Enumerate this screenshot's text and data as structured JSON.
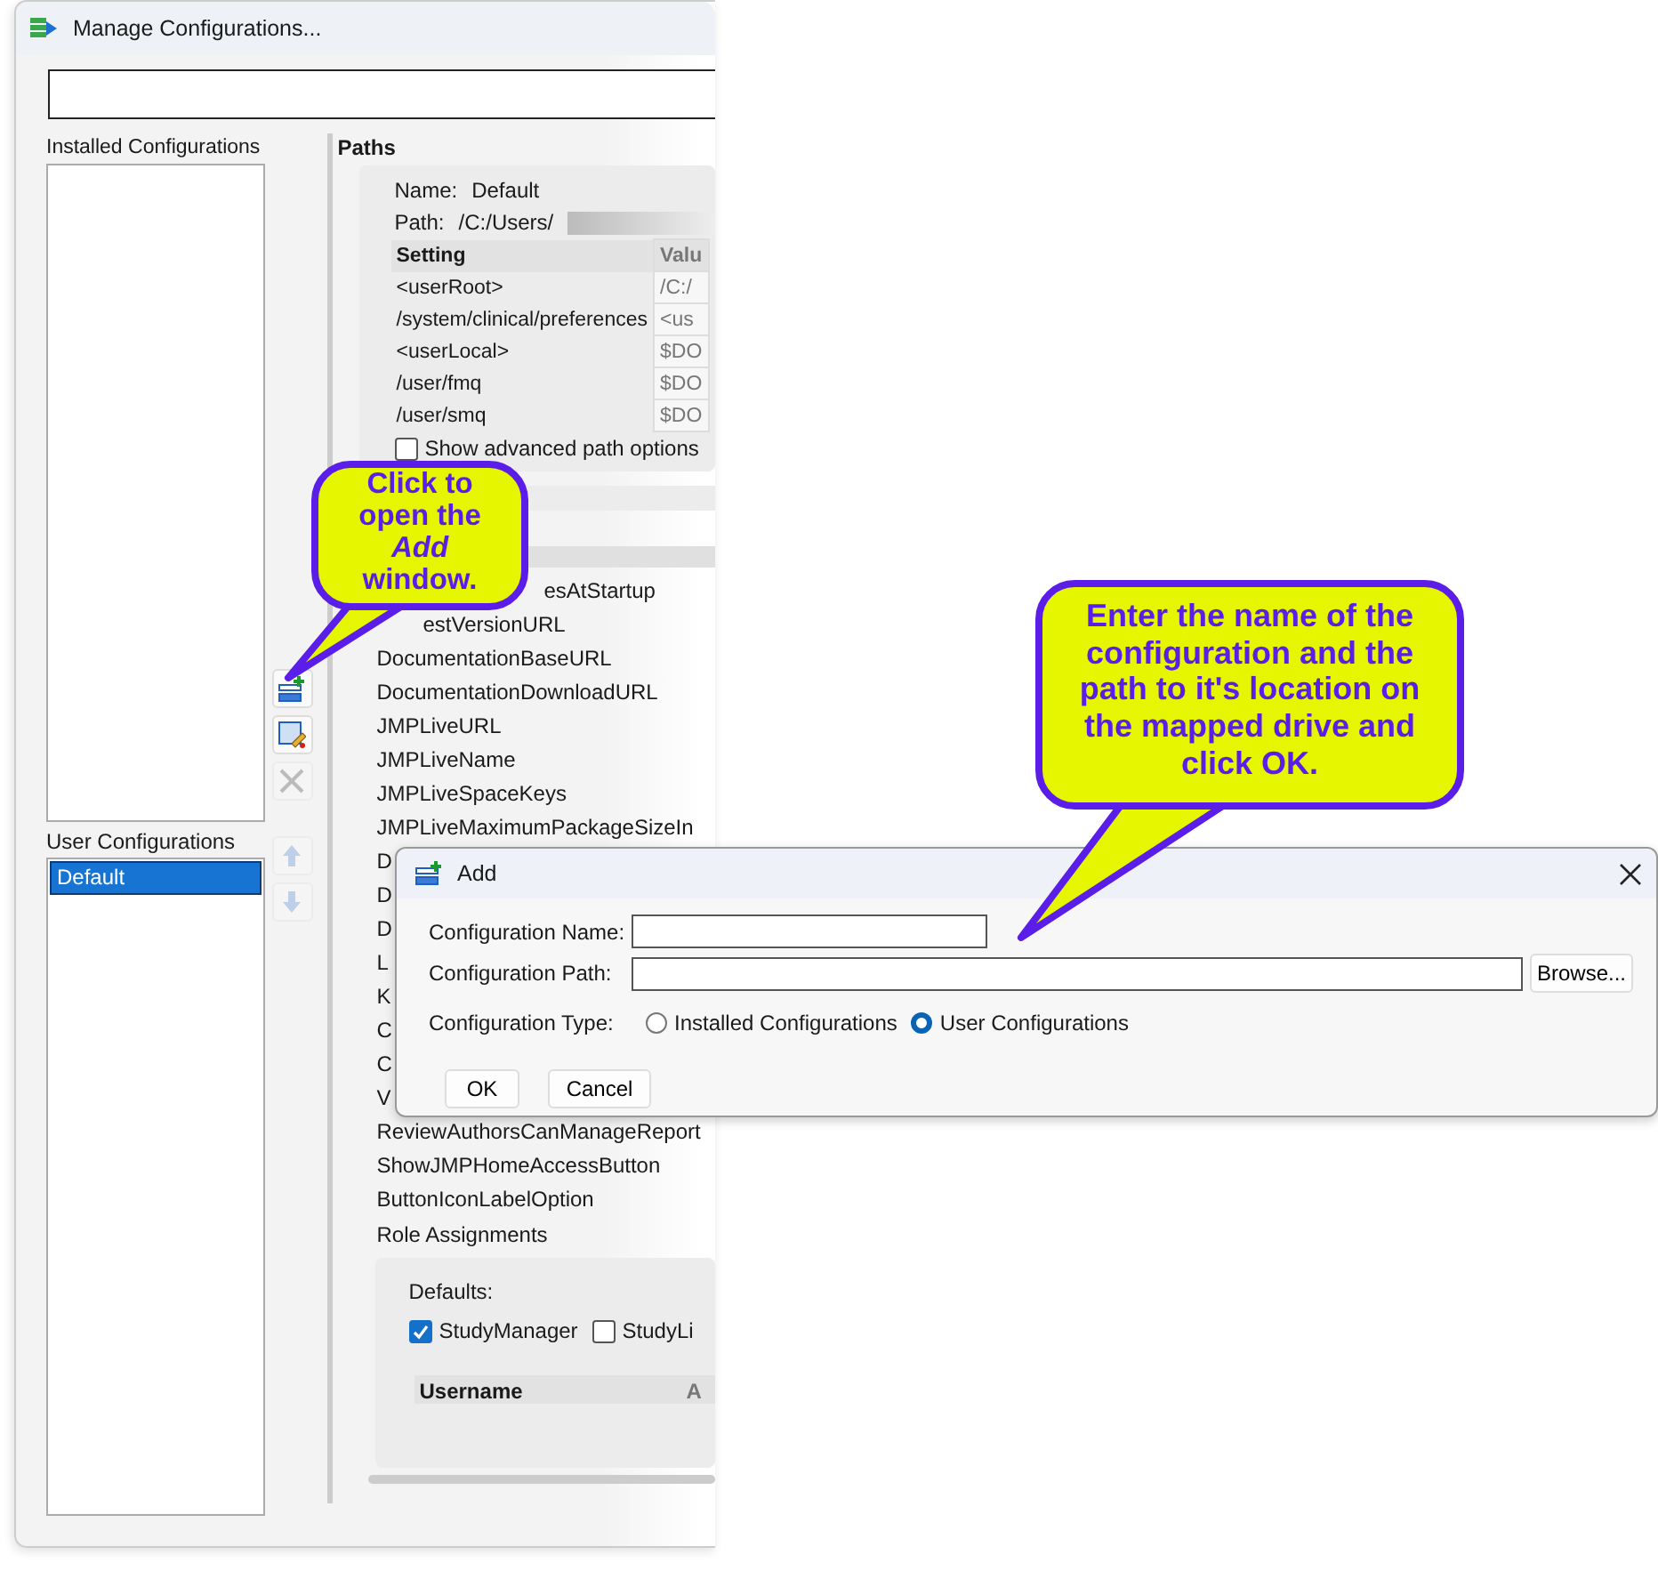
{
  "window": {
    "title": "Manage Configurations..."
  },
  "installed_configurations": {
    "label": "Installed Configurations"
  },
  "user_configurations": {
    "label": "User Configurations",
    "items": [
      {
        "text": "Default",
        "selected": true
      }
    ]
  },
  "list_buttons": [
    {
      "kind": "add",
      "disabled": false
    },
    {
      "kind": "edit",
      "disabled": false
    },
    {
      "kind": "delete",
      "disabled": true
    },
    {
      "kind": "up",
      "disabled": true
    },
    {
      "kind": "down",
      "disabled": true
    }
  ],
  "paths": {
    "title": "Paths",
    "name_label": "Name:",
    "name": "Default",
    "path_label": "Path:",
    "path": "/C:/Users/",
    "columns": [
      "Setting",
      "Valu"
    ],
    "rows": [
      [
        "<userRoot>",
        "/C:/"
      ],
      [
        "/system/clinical/preferences",
        "<us"
      ],
      [
        "<userLocal>",
        "$DO"
      ],
      [
        "/user/fmq",
        "$DO"
      ],
      [
        "/user/smq",
        "$DO"
      ]
    ],
    "advanced_option": {
      "label": "Show advanced path options",
      "checked": false
    }
  },
  "settings": [
    {
      "text": "esAtStartup",
      "partial": true
    },
    {
      "text": "estVersionURL",
      "partial": true
    },
    {
      "text": "DocumentationBaseURL",
      "partial": false
    },
    {
      "text": "DocumentationDownloadURL",
      "partial": false
    },
    {
      "text": "JMPLiveURL",
      "partial": false
    },
    {
      "text": "JMPLiveName",
      "partial": false
    },
    {
      "text": "JMPLiveSpaceKeys",
      "partial": false
    },
    {
      "text": "JMPLiveMaximumPackageSizeIn",
      "partial": false
    },
    {
      "text": "D",
      "partial": false
    },
    {
      "text": "D",
      "partial": false
    },
    {
      "text": "D",
      "partial": false
    },
    {
      "text": "L",
      "partial": false
    },
    {
      "text": "K",
      "partial": false
    },
    {
      "text": "C",
      "partial": false
    },
    {
      "text": "C",
      "partial": false
    },
    {
      "text": "V",
      "partial": false
    },
    {
      "text": "ReviewAuthorsCanManageReport",
      "partial": false
    },
    {
      "text": "ShowJMPHomeAccessButton",
      "partial": false
    },
    {
      "text": "ButtonIconLabelOption",
      "partial": false
    }
  ],
  "role_assignments": {
    "title": "Role Assignments",
    "defaults_label": "Defaults:",
    "roles": [
      {
        "label": "StudyManager",
        "checked": true
      },
      {
        "label": "StudyLi",
        "checked": false
      }
    ],
    "columns": [
      "Username",
      "A"
    ]
  },
  "dialog": {
    "title": "Add",
    "name_label": "Configuration Name:",
    "path_label": "Configuration Path:",
    "browse": "Browse...",
    "type_label": "Configuration Type:",
    "types": [
      {
        "label": "Installed Configurations",
        "selected": false
      },
      {
        "label": "User Configurations",
        "selected": true
      }
    ],
    "buttons": [
      "OK",
      "Cancel"
    ]
  },
  "callouts": [
    {
      "text": "Click to open the *Add* window."
    },
    {
      "text": "Enter the name of the configuration and the path to it's location on the mapped drive and click OK."
    }
  ]
}
